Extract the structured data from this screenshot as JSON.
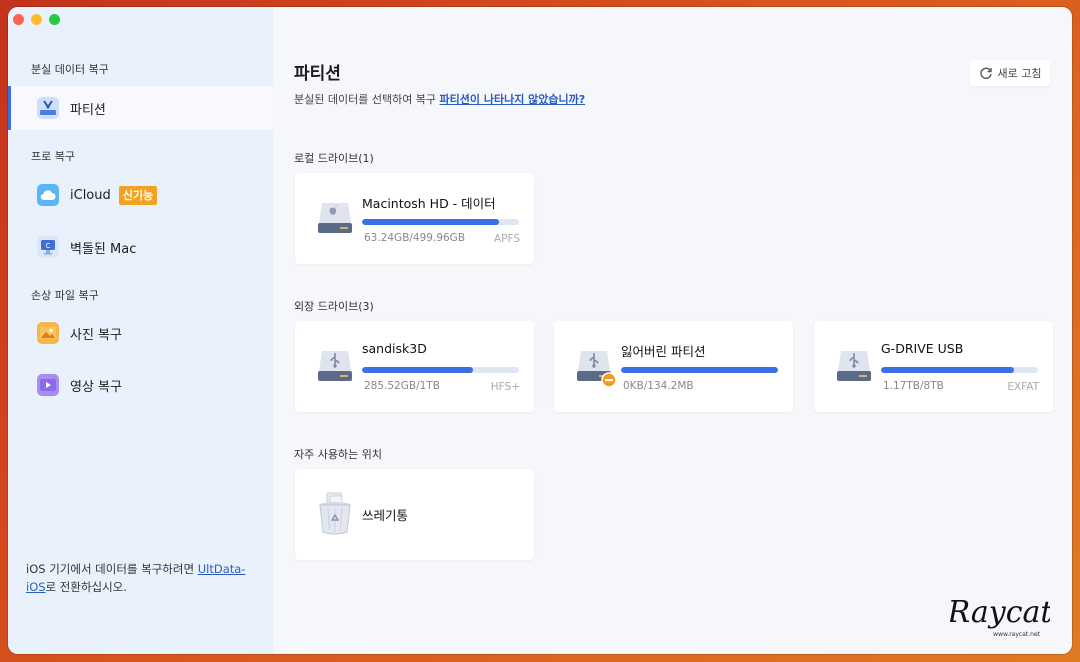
{
  "sidebar": {
    "section_lost": "분실 데이터 복구",
    "section_pro": "프로 복구",
    "section_damaged": "손상 파일 복구",
    "items": [
      {
        "label": "파티션"
      },
      {
        "label": "iCloud",
        "badge": "신기능"
      },
      {
        "label": "벽돌된 Mac"
      },
      {
        "label": "사진 복구"
      },
      {
        "label": "영상 복구"
      }
    ],
    "footer_prefix": "iOS 기기에서 데이터를 복구하려면 ",
    "footer_link": "UltData-iOS",
    "footer_suffix": "로 전환하십시오."
  },
  "main": {
    "title": "파티션",
    "subtitle_prefix": "분실된 데이터를 선택하여 복구 ",
    "subtitle_link": "파티션이 나타나지 않았습니까?",
    "refresh_label": "새로 고침",
    "local_label": "로컬 드라이브(1)",
    "external_label": "외장 드라이브(3)",
    "frequent_label": "자주 사용하는 위치",
    "local_drives": [
      {
        "name": "Macintosh HD - 데이터",
        "size": "63.24GB/499.96GB",
        "fs": "APFS",
        "fill": 0.87
      }
    ],
    "external_drives": [
      {
        "name": "sandisk3D",
        "size": "285.52GB/1TB",
        "fs": "HFS+",
        "fill": 0.71
      },
      {
        "name": "잃어버린 파티션",
        "size": "0KB/134.2MB",
        "fs": "",
        "fill": 1.0
      },
      {
        "name": "G-DRIVE USB",
        "size": "1.17TB/8TB",
        "fs": "EXFAT",
        "fill": 0.85
      }
    ],
    "frequent": [
      {
        "name": "쓰레기통"
      }
    ]
  },
  "watermark": {
    "text": "Raycat",
    "url": "www.raycat.net"
  },
  "colors": {
    "accent": "#3a6fe8",
    "badge": "#f3a322",
    "link": "#2a5cc4"
  }
}
